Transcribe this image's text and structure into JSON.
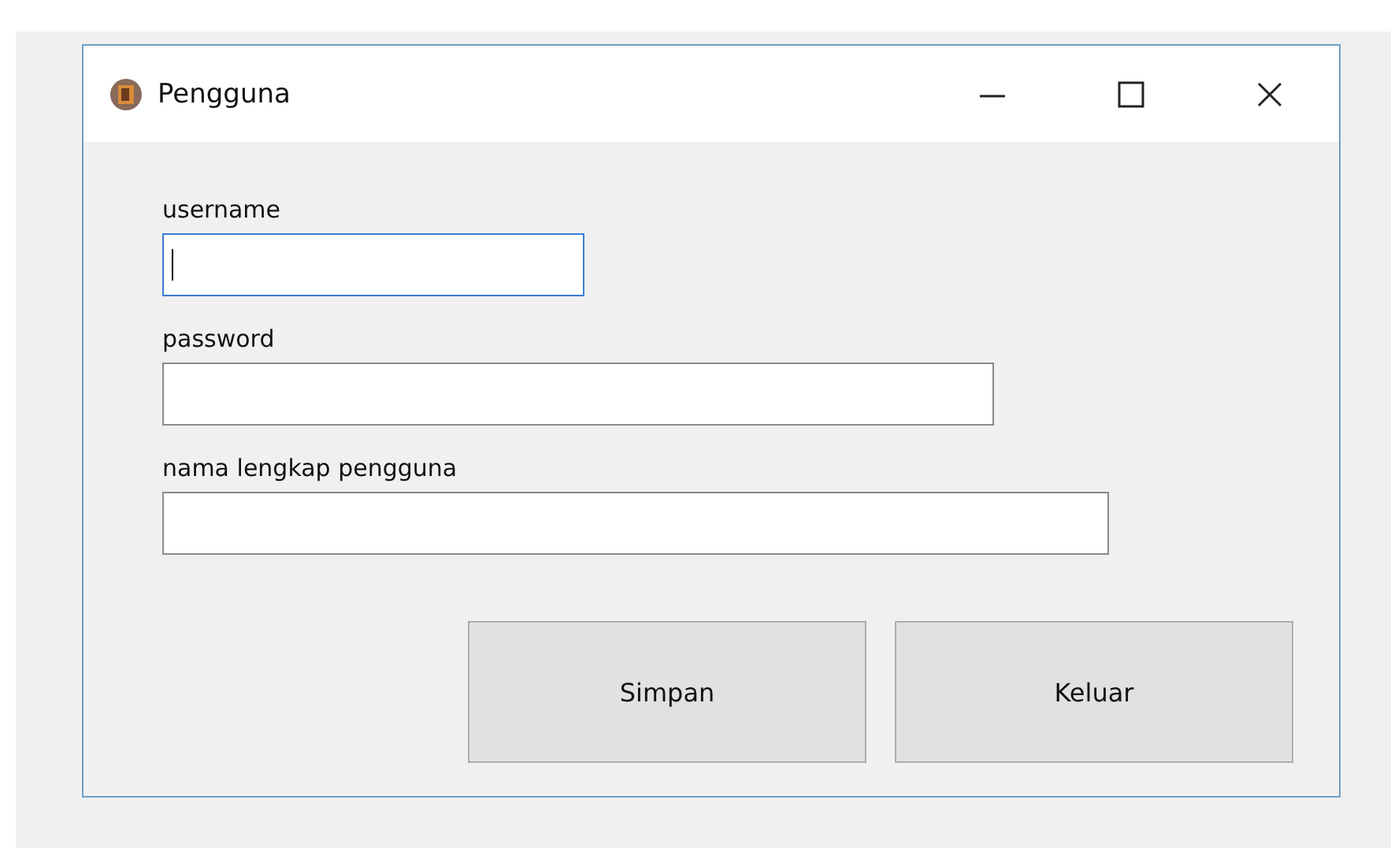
{
  "window": {
    "title": "Pengguna"
  },
  "fields": [
    {
      "label": "username",
      "focused": true
    },
    {
      "label": "password",
      "focused": false
    },
    {
      "label": "nama lengkap pengguna",
      "focused": false
    }
  ],
  "buttons": [
    "Simpan",
    "Keluar"
  ]
}
